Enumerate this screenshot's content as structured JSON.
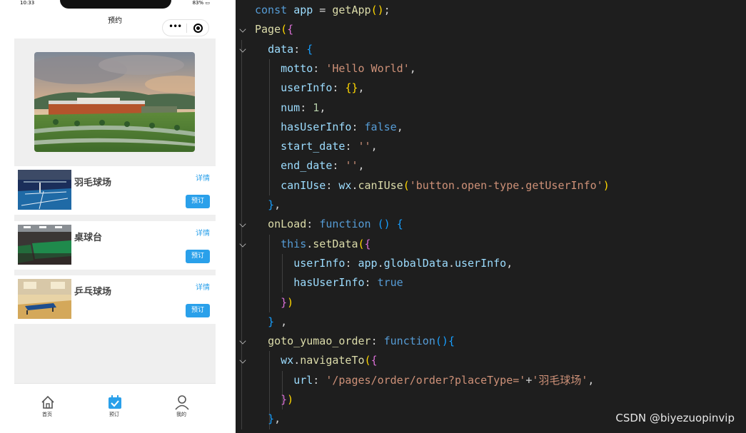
{
  "phone": {
    "status": {
      "time": "10:33",
      "battery": "83% ▭"
    },
    "nav_title": "预约",
    "capsule": {
      "more_icon": "ellipsis-icon",
      "close_icon": "target-icon"
    },
    "venues": [
      {
        "name": "羽毛球场",
        "detail": "详情",
        "book": "预订"
      },
      {
        "name": "桌球台",
        "detail": "详情",
        "book": "预订"
      },
      {
        "name": "乒乓球场",
        "detail": "详情",
        "book": "预订"
      }
    ],
    "tabs": [
      {
        "label": "首页",
        "icon": "home-icon",
        "active": false
      },
      {
        "label": "预订",
        "icon": "calendar-check-icon",
        "active": true
      },
      {
        "label": "我的",
        "icon": "user-icon",
        "active": false
      }
    ],
    "colors": {
      "accent": "#2aa0ea"
    }
  },
  "editor": {
    "lines": [
      [
        [
          "c-kw",
          "const "
        ],
        [
          "c-var",
          "app"
        ],
        [
          "c-plain",
          " = "
        ],
        [
          "c-fn",
          "getApp"
        ],
        [
          "c-br1",
          "()"
        ],
        [
          "c-plain",
          ";"
        ]
      ],
      [
        [
          "c-fn",
          "Page"
        ],
        [
          "c-br1",
          "("
        ],
        [
          "c-br2",
          "{"
        ]
      ],
      [
        [
          "c-plain",
          "  "
        ],
        [
          "c-prop",
          "data"
        ],
        [
          "c-plain",
          ": "
        ],
        [
          "c-br3",
          "{"
        ]
      ],
      [
        [
          "c-plain",
          "    "
        ],
        [
          "c-prop",
          "motto"
        ],
        [
          "c-plain",
          ": "
        ],
        [
          "c-str",
          "'Hello World'"
        ],
        [
          "c-plain",
          ","
        ]
      ],
      [
        [
          "c-plain",
          "    "
        ],
        [
          "c-prop",
          "userInfo"
        ],
        [
          "c-plain",
          ": "
        ],
        [
          "c-br1",
          "{}"
        ],
        [
          "c-plain",
          ","
        ]
      ],
      [
        [
          "c-plain",
          "    "
        ],
        [
          "c-prop",
          "num"
        ],
        [
          "c-plain",
          ": "
        ],
        [
          "c-num",
          "1"
        ],
        [
          "c-plain",
          ","
        ]
      ],
      [
        [
          "c-plain",
          "    "
        ],
        [
          "c-prop",
          "hasUserInfo"
        ],
        [
          "c-plain",
          ": "
        ],
        [
          "c-bool",
          "false"
        ],
        [
          "c-plain",
          ","
        ]
      ],
      [
        [
          "c-plain",
          "    "
        ],
        [
          "c-prop",
          "start_date"
        ],
        [
          "c-plain",
          ": "
        ],
        [
          "c-str",
          "''"
        ],
        [
          "c-plain",
          ","
        ]
      ],
      [
        [
          "c-plain",
          "    "
        ],
        [
          "c-prop",
          "end_date"
        ],
        [
          "c-plain",
          ": "
        ],
        [
          "c-str",
          "''"
        ],
        [
          "c-plain",
          ","
        ]
      ],
      [
        [
          "c-plain",
          "    "
        ],
        [
          "c-prop",
          "canIUse"
        ],
        [
          "c-plain",
          ": "
        ],
        [
          "c-var",
          "wx"
        ],
        [
          "c-plain",
          "."
        ],
        [
          "c-fn",
          "canIUse"
        ],
        [
          "c-br1",
          "("
        ],
        [
          "c-str",
          "'button.open-type.getUserInfo'"
        ],
        [
          "c-br1",
          ")"
        ]
      ],
      [
        [
          "c-plain",
          "  "
        ],
        [
          "c-br3",
          "}"
        ],
        [
          "c-plain",
          ","
        ]
      ],
      [
        [
          "c-plain",
          "  "
        ],
        [
          "c-fn",
          "onLoad"
        ],
        [
          "c-plain",
          ": "
        ],
        [
          "c-kw",
          "function "
        ],
        [
          "c-br3",
          "()"
        ],
        [
          "c-plain",
          " "
        ],
        [
          "c-br3",
          "{"
        ]
      ],
      [
        [
          "c-plain",
          "    "
        ],
        [
          "c-this",
          "this"
        ],
        [
          "c-plain",
          "."
        ],
        [
          "c-fn",
          "setData"
        ],
        [
          "c-br1",
          "("
        ],
        [
          "c-br2",
          "{"
        ]
      ],
      [
        [
          "c-plain",
          "      "
        ],
        [
          "c-prop",
          "userInfo"
        ],
        [
          "c-plain",
          ": "
        ],
        [
          "c-var",
          "app"
        ],
        [
          "c-plain",
          "."
        ],
        [
          "c-var",
          "globalData"
        ],
        [
          "c-plain",
          "."
        ],
        [
          "c-var",
          "userInfo"
        ],
        [
          "c-plain",
          ","
        ]
      ],
      [
        [
          "c-plain",
          "      "
        ],
        [
          "c-prop",
          "hasUserInfo"
        ],
        [
          "c-plain",
          ": "
        ],
        [
          "c-bool",
          "true"
        ]
      ],
      [
        [
          "c-plain",
          "    "
        ],
        [
          "c-br2",
          "}"
        ],
        [
          "c-br1",
          ")"
        ]
      ],
      [
        [
          "c-plain",
          "  "
        ],
        [
          "c-br3",
          "}"
        ],
        [
          "c-plain",
          " ,"
        ]
      ],
      [
        [
          "c-plain",
          "  "
        ],
        [
          "c-fn",
          "goto_yumao_order"
        ],
        [
          "c-plain",
          ": "
        ],
        [
          "c-kw",
          "function"
        ],
        [
          "c-br3",
          "()"
        ],
        [
          "c-br3",
          "{"
        ]
      ],
      [
        [
          "c-plain",
          "    "
        ],
        [
          "c-var",
          "wx"
        ],
        [
          "c-plain",
          "."
        ],
        [
          "c-fn",
          "navigateTo"
        ],
        [
          "c-br1",
          "("
        ],
        [
          "c-br2",
          "{"
        ]
      ],
      [
        [
          "c-plain",
          "      "
        ],
        [
          "c-prop",
          "url"
        ],
        [
          "c-plain",
          ": "
        ],
        [
          "c-str",
          "'/pages/order/order?placeType='"
        ],
        [
          "c-plain",
          "+"
        ],
        [
          "c-str",
          "'羽毛球场'"
        ],
        [
          "c-plain",
          ","
        ]
      ],
      [
        [
          "c-plain",
          "    "
        ],
        [
          "c-br2",
          "}"
        ],
        [
          "c-br1",
          ")"
        ]
      ],
      [
        [
          "c-plain",
          "  "
        ],
        [
          "c-br3",
          "}"
        ],
        [
          "c-plain",
          ","
        ]
      ]
    ],
    "watermark": "CSDN @biyezuopinvip"
  }
}
